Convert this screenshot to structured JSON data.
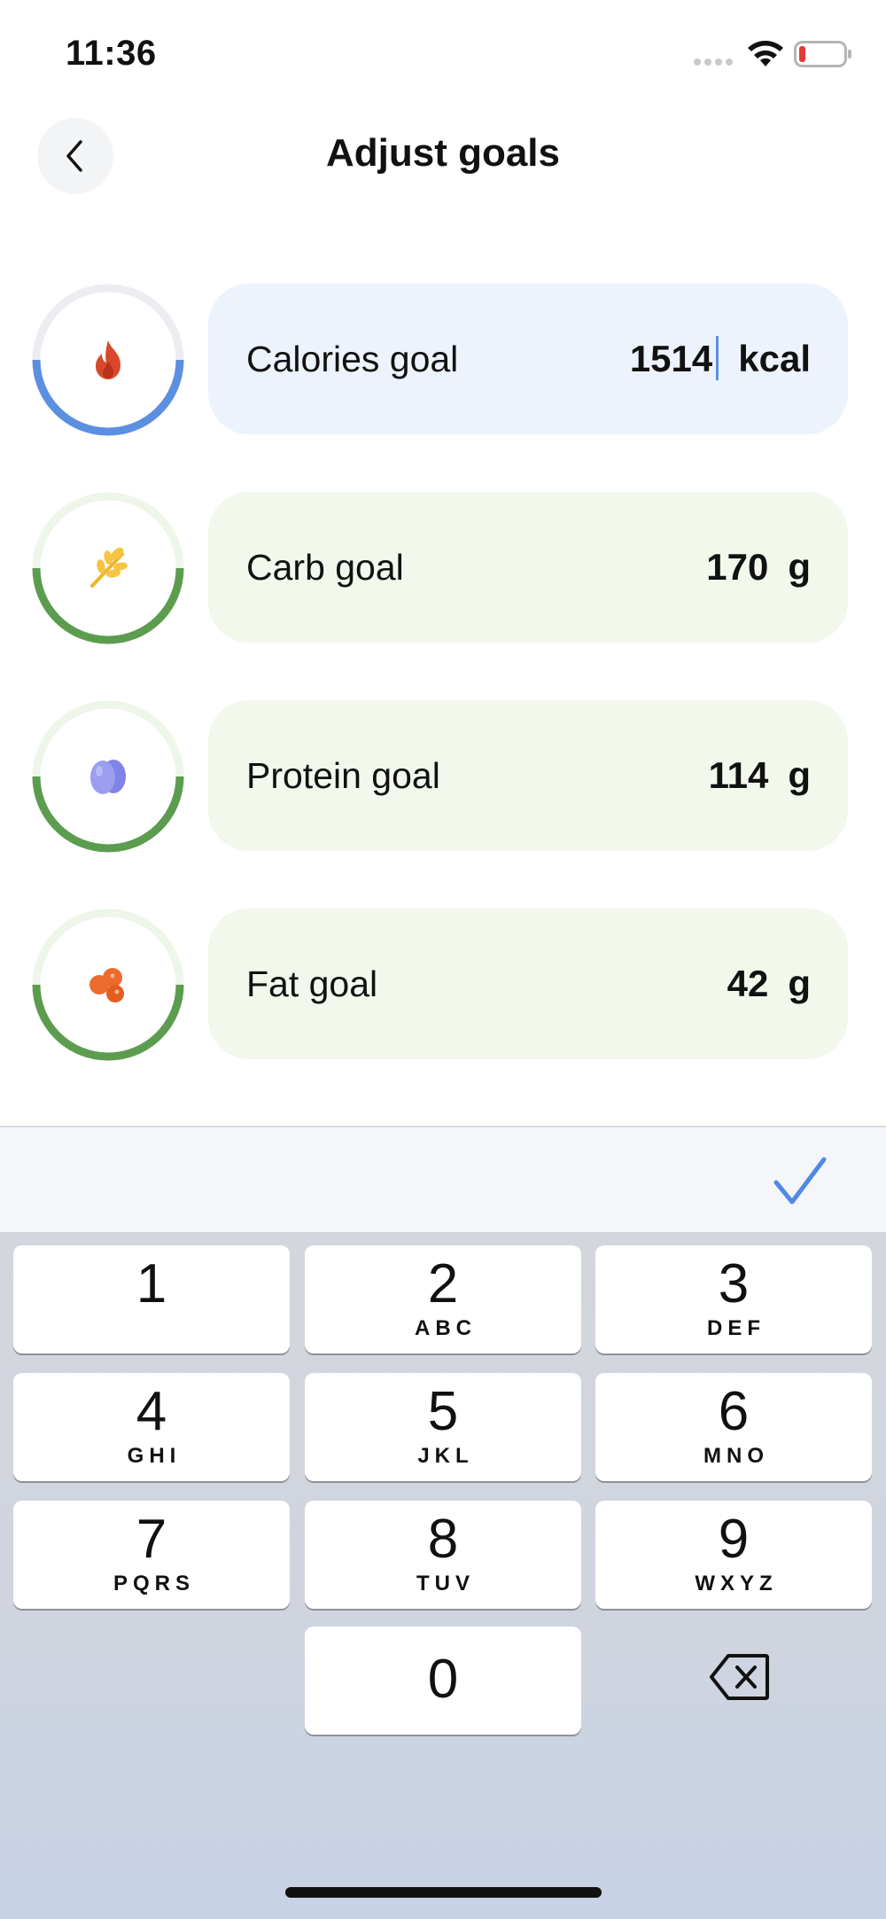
{
  "status_bar": {
    "time": "11:36",
    "wifi_icon": "wifi-icon",
    "battery_icon": "battery-low-icon"
  },
  "header": {
    "title": "Adjust goals",
    "back_icon": "chevron-left-icon"
  },
  "colors": {
    "accent_blue": "#5b8fe0",
    "ring_green": "#5c9c4f",
    "card_blue": "#edf3fc",
    "card_green": "#f2f8ec"
  },
  "goals": [
    {
      "label": "Calories goal",
      "value": "1514",
      "unit": "kcal",
      "icon": "fire-icon",
      "active": true
    },
    {
      "label": "Carb goal",
      "value": "170",
      "unit": "g",
      "icon": "wheat-icon",
      "active": false
    },
    {
      "label": "Protein goal",
      "value": "114",
      "unit": "g",
      "icon": "eggs-icon",
      "active": false
    },
    {
      "label": "Fat goal",
      "value": "42",
      "unit": "g",
      "icon": "nuts-icon",
      "active": false
    }
  ],
  "accessory": {
    "done_icon": "checkmark-icon"
  },
  "keyboard": {
    "keys": [
      {
        "digit": "1",
        "letters": ""
      },
      {
        "digit": "2",
        "letters": "ABC"
      },
      {
        "digit": "3",
        "letters": "DEF"
      },
      {
        "digit": "4",
        "letters": "GHI"
      },
      {
        "digit": "5",
        "letters": "JKL"
      },
      {
        "digit": "6",
        "letters": "MNO"
      },
      {
        "digit": "7",
        "letters": "PQRS"
      },
      {
        "digit": "8",
        "letters": "TUV"
      },
      {
        "digit": "9",
        "letters": "WXYZ"
      },
      {
        "digit": "0",
        "letters": ""
      }
    ],
    "delete_icon": "backspace-icon"
  }
}
